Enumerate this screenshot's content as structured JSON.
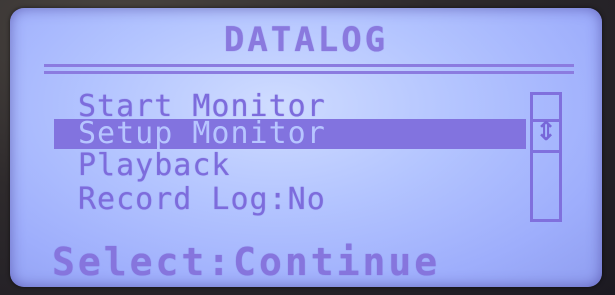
{
  "screen": {
    "title": "DATALOG",
    "menu": {
      "items": [
        {
          "label": "Start Monitor",
          "selected": false
        },
        {
          "label": "Setup Monitor",
          "selected": true
        },
        {
          "label": "Playback",
          "selected": false
        },
        {
          "label": "Record Log:No",
          "selected": false
        }
      ]
    },
    "scrollbar": {
      "icon": "up-down-arrow-icon",
      "glyph": "⇕"
    },
    "footer": "Select:Continue"
  },
  "colors": {
    "lcd_background": "#b3c4ff",
    "lcd_foreground": "#7d6cdc",
    "highlight_bar": "#8273df"
  }
}
